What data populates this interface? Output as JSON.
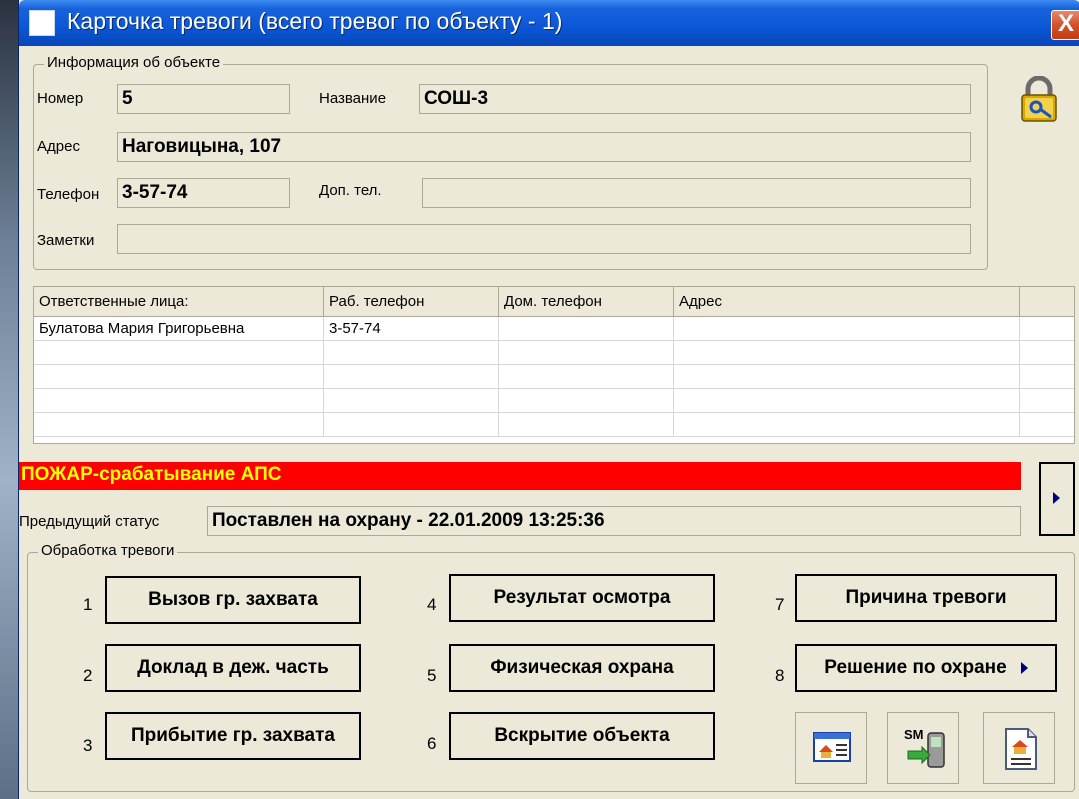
{
  "window": {
    "title": "Карточка тревоги (всего тревог по объекту - 1)",
    "close_label": "X"
  },
  "object_info": {
    "legend": "Информация об объекте",
    "number_label": "Номер",
    "number_value": "5",
    "name_label": "Название",
    "name_value": "СОШ-3",
    "address_label": "Адрес",
    "address_value": "Наговицына, 107",
    "phone_label": "Телефон",
    "phone_value": "3-57-74",
    "extra_phone_label": "Доп. тел.",
    "extra_phone_value": "",
    "notes_label": "Заметки",
    "notes_value": ""
  },
  "responsible": {
    "columns": [
      "Ответственные лица:",
      "Раб. телефон",
      "Дом. телефон",
      "Адрес"
    ],
    "rows": [
      [
        "Булатова Мария Григорьевна",
        "3-57-74",
        "",
        ""
      ]
    ]
  },
  "alarm": {
    "text": "ПОЖАР-срабатывание АПС",
    "color_bg": "#ff0000",
    "color_text": "#ffff00",
    "prev_status_label": "Предыдущий статус",
    "prev_status_value": "Поставлен на охрану - 22.01.2009 13:25:36"
  },
  "processing": {
    "legend": "Обработка тревоги",
    "actions": [
      {
        "num": "1",
        "label": "Вызов гр. захвата"
      },
      {
        "num": "2",
        "label": "Доклад в деж. часть"
      },
      {
        "num": "3",
        "label": "Прибытие гр. захвата"
      },
      {
        "num": "4",
        "label": "Результат осмотра"
      },
      {
        "num": "5",
        "label": "Физическая охрана"
      },
      {
        "num": "6",
        "label": "Вскрытие объекта"
      },
      {
        "num": "7",
        "label": "Причина тревоги"
      },
      {
        "num": "8",
        "label": "Решение по охране"
      }
    ],
    "icons": [
      "object-card-icon",
      "sms-phone-icon",
      "document-icon"
    ]
  },
  "icons": {
    "lock": "padlock-key-icon"
  }
}
